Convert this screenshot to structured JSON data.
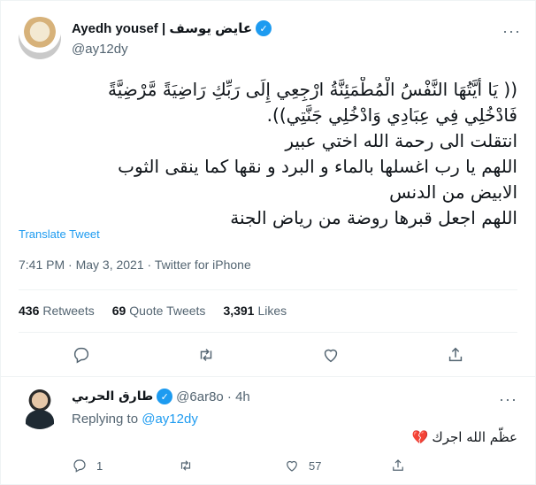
{
  "author": {
    "display_name": "Ayedh yousef | عايض يوسف",
    "handle": "@ay12dy"
  },
  "tweet": {
    "lines": [
      "(( يَا أَيَّتُهَا النَّفْسُ الْمُطْمَئِنَّةُ ارْجِعِي إِلَى رَبِّكِ رَاضِيَةً مَّرْضِيَّةً",
      "فَادْخُلِي فِي عِبَادِي وَادْخُلِي جَنَّتِي)).",
      "انتقلت الى رحمة الله اختي عبير",
      "اللهم يا رب اغسلها بالماء و البرد و نقها كما ينقى الثوب",
      "الابيض من الدنس",
      "اللهم اجعل قبرها روضة من رياض الجنة"
    ],
    "translate_label": "Translate Tweet",
    "timestamp": "7:41 PM · May 3, 2021 · Twitter for iPhone"
  },
  "stats": {
    "retweets_count": "436",
    "retweets_label": "Retweets",
    "quotes_count": "69",
    "quotes_label": "Quote Tweets",
    "likes_count": "3,391",
    "likes_label": "Likes"
  },
  "actions": [
    "reply-icon",
    "retweet-icon",
    "like-icon",
    "share-icon"
  ],
  "reply": {
    "display_name": "طارق الحربي",
    "meta": "@6ar8o · 4h",
    "replying_prefix": "Replying to",
    "replying_handle": "@ay12dy",
    "text": "عظّم الله اجرك",
    "reply_count": "1",
    "retweet_count": "",
    "like_count": "57"
  },
  "colors": {
    "accent": "#1d9bf0",
    "text": "#0f1419",
    "muted": "#536471",
    "heart": "#e0245e"
  }
}
